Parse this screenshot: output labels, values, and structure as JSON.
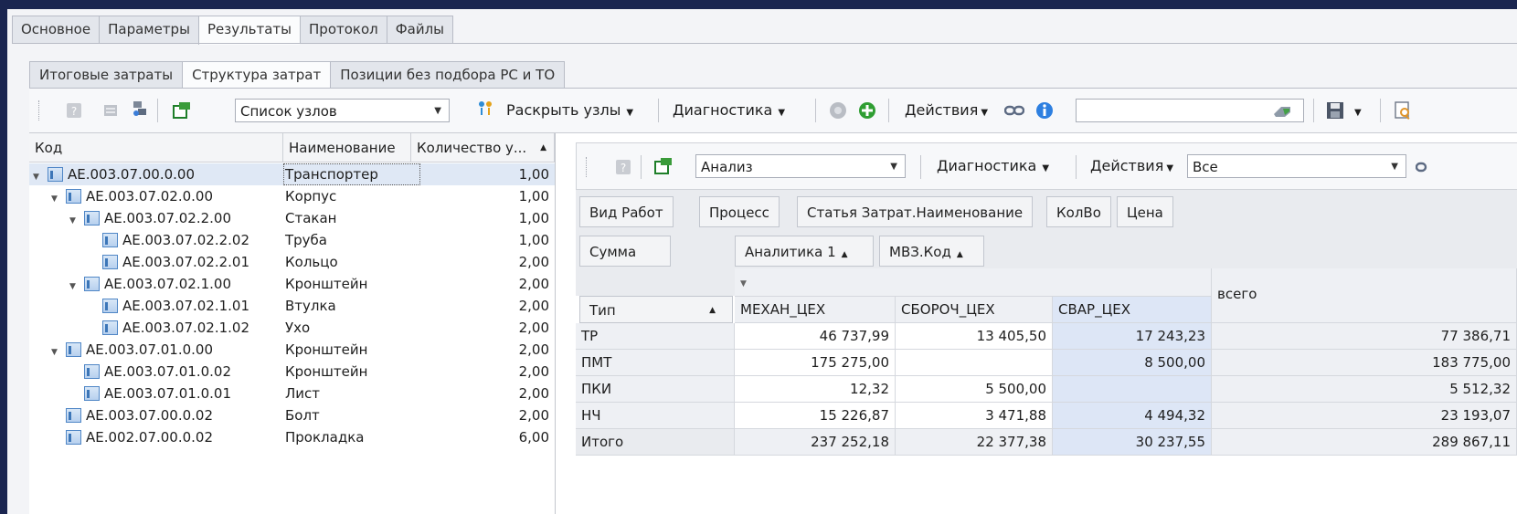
{
  "main_tabs": [
    "Основное",
    "Параметры",
    "Результаты",
    "Протокол",
    "Файлы"
  ],
  "active_main_tab": "Результаты",
  "sub_tabs": [
    "Итоговые затраты",
    "Структура затрат",
    "Позиции без подбора РС и ТО"
  ],
  "active_sub_tab": "Структура затрат",
  "toolbar": {
    "combo_value": "Список узлов",
    "expand_nodes": "Раскрыть узлы",
    "diagnostics": "Диагностика",
    "actions": "Действия",
    "search_value": ""
  },
  "tree": {
    "headers": {
      "code": "Код",
      "name": "Наименование",
      "qty": "Количество у..."
    },
    "rows": [
      {
        "code": "AE.003.07.00.0.00",
        "name": "Транспортер",
        "qty": "1,00",
        "level": 0,
        "expand": true
      },
      {
        "code": "AE.003.07.02.0.00",
        "name": "Корпус",
        "qty": "1,00",
        "level": 1,
        "expand": true
      },
      {
        "code": "AE.003.07.02.2.00",
        "name": "Стакан",
        "qty": "1,00",
        "level": 2,
        "expand": true
      },
      {
        "code": "AE.003.07.02.2.02",
        "name": "Труба",
        "qty": "1,00",
        "level": 3,
        "expand": false
      },
      {
        "code": "AE.003.07.02.2.01",
        "name": "Кольцо",
        "qty": "2,00",
        "level": 3,
        "expand": false
      },
      {
        "code": "AE.003.07.02.1.00",
        "name": "Кронштейн",
        "qty": "2,00",
        "level": 2,
        "expand": true
      },
      {
        "code": "AE.003.07.02.1.01",
        "name": "Втулка",
        "qty": "2,00",
        "level": 3,
        "expand": false
      },
      {
        "code": "AE.003.07.02.1.02",
        "name": "Ухо",
        "qty": "2,00",
        "level": 3,
        "expand": false
      },
      {
        "code": "AE.003.07.01.0.00",
        "name": "Кронштейн",
        "qty": "2,00",
        "level": 1,
        "expand": true
      },
      {
        "code": "AE.003.07.01.0.02",
        "name": "Кронштейн",
        "qty": "2,00",
        "level": 2,
        "expand": false
      },
      {
        "code": "AE.003.07.01.0.01",
        "name": "Лист",
        "qty": "2,00",
        "level": 2,
        "expand": false
      },
      {
        "code": "AE.003.07.00.0.02",
        "name": "Болт",
        "qty": "2,00",
        "level": 1,
        "expand": false
      },
      {
        "code": "AE.002.07.00.0.02",
        "name": "Прокладка",
        "qty": "6,00",
        "level": 1,
        "expand": false
      }
    ]
  },
  "right_toolbar": {
    "combo_value": "Анализ",
    "diagnostics": "Диагностика",
    "actions": "Действия",
    "filter_value": "Все"
  },
  "pivot": {
    "filter_fields": [
      "Вид Работ",
      "Процесс",
      "Статья Затрат.Наименование",
      "КолВо",
      "Цена"
    ],
    "data_field": "Сумма",
    "column_fields": [
      "Аналитика 1",
      "МВЗ.Код"
    ],
    "row_field": "Тип",
    "columns": [
      "МЕХАН_ЦЕХ",
      "СБОРОЧ_ЦЕХ",
      "СВАР_ЦЕХ"
    ],
    "total_label": "всего",
    "rows": [
      {
        "label": "ТР",
        "values": [
          "46 737,99",
          "13 405,50",
          "17 243,23"
        ],
        "total": "77 386,71"
      },
      {
        "label": "ПМТ",
        "values": [
          "175 275,00",
          "",
          "8 500,00"
        ],
        "total": "183 775,00"
      },
      {
        "label": "ПКИ",
        "values": [
          "12,32",
          "5 500,00",
          ""
        ],
        "total": "5 512,32"
      },
      {
        "label": "НЧ",
        "values": [
          "15 226,87",
          "3 471,88",
          "4 494,32"
        ],
        "total": "23 193,07"
      },
      {
        "label": "Итого",
        "values": [
          "237 252,18",
          "22 377,38",
          "30 237,55"
        ],
        "total": "289 867,11"
      }
    ]
  }
}
